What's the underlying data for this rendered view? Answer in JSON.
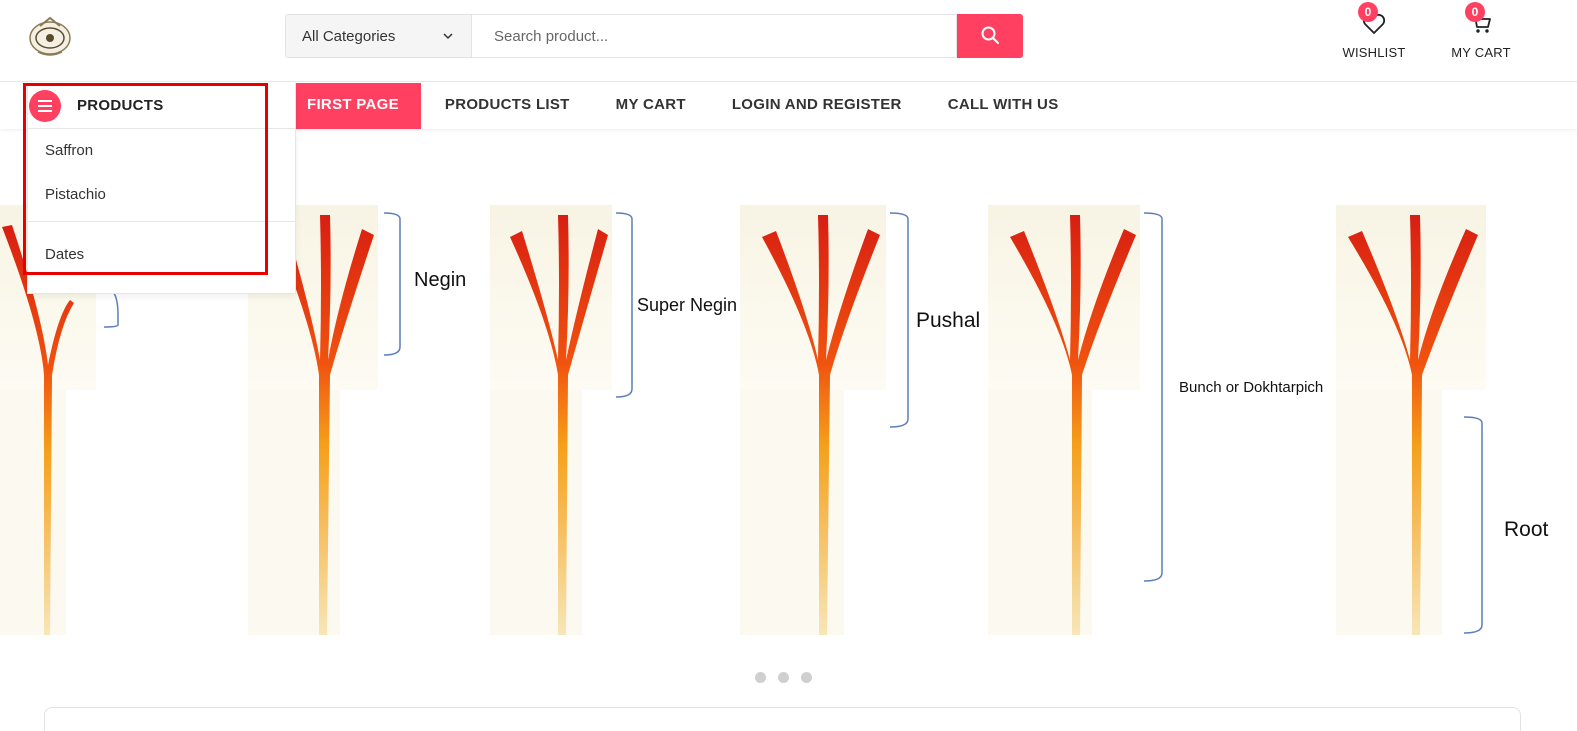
{
  "header": {
    "category_select": "All Categories",
    "search_placeholder": "Search product...",
    "wishlist": {
      "label": "WISHLIST",
      "count": "0"
    },
    "cart": {
      "label": "MY CART",
      "count": "0"
    }
  },
  "nav": {
    "items": [
      "FIRST PAGE",
      "PRODUCTS LIST",
      "MY CART",
      "LOGIN AND REGISTER",
      "CALL WITH US"
    ]
  },
  "products_menu": {
    "title": "PRODUCTS",
    "items": [
      "Saffron",
      "Pistachio",
      "Dates"
    ]
  },
  "hero": {
    "labels": [
      "Negin",
      "Super Negin",
      "Pushal",
      "Bunch or Dokhtarpich",
      "Root"
    ]
  },
  "colors": {
    "accent": "#ff4061",
    "highlight": "#e60000",
    "bracket": "#5b7fb8"
  },
  "icons": [
    "logo",
    "chevron-down-icon",
    "search-icon",
    "heart-icon",
    "cart-icon",
    "menu-icon"
  ]
}
